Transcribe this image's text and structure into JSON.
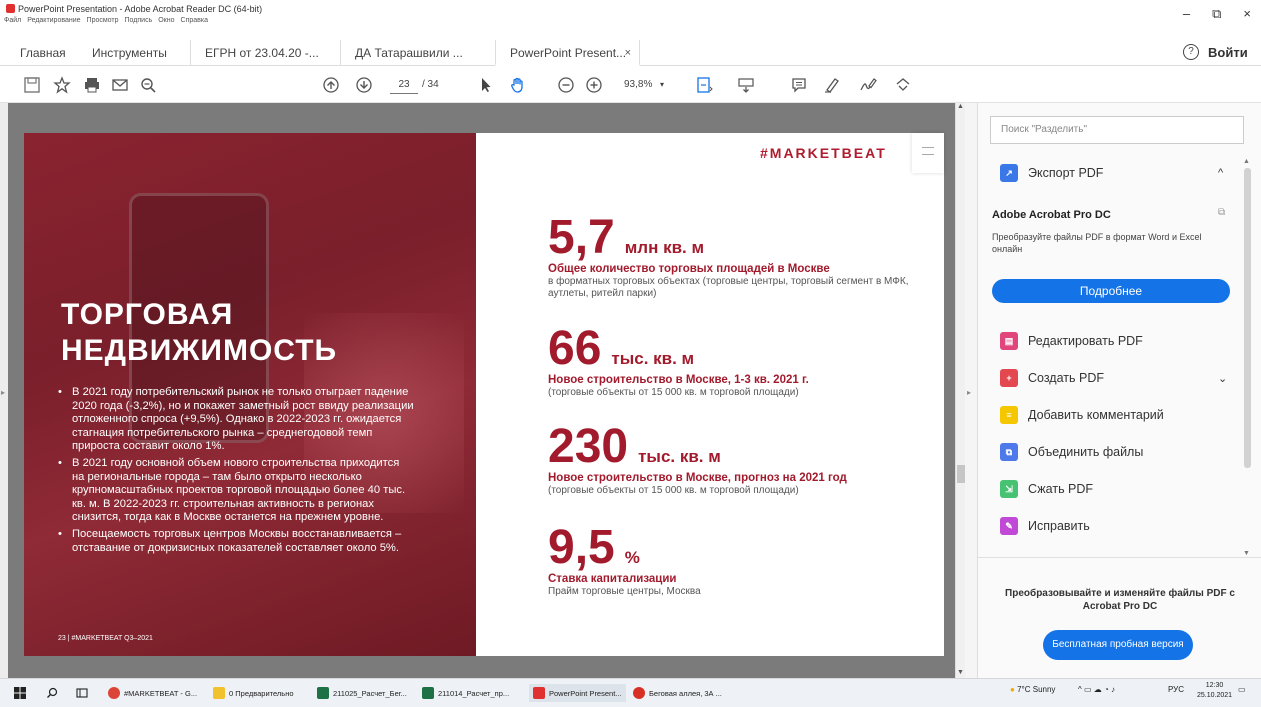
{
  "window": {
    "title": "PowerPoint Presentation - Adobe Acrobat Reader DC (64-bit)",
    "menu": [
      "Файл",
      "Редактирование",
      "Просмотр",
      "Подпись",
      "Окно",
      "Справка"
    ],
    "controls": {
      "minimize": "–",
      "maximize": "⧉",
      "close": "×"
    }
  },
  "tabs": {
    "home": "Главная",
    "tools": "Инструменты",
    "docs": [
      {
        "label": "ЕГРН от 23.04.20 -..."
      },
      {
        "label": "ДА Татарашвили ..."
      },
      {
        "label": "PowerPoint Present...",
        "close": "×"
      }
    ],
    "help": "?",
    "login": "Войти"
  },
  "toolbar": {
    "page_current": "23",
    "page_total": "/ 34",
    "zoom": "93,8%",
    "zoom_arrow": "▾"
  },
  "slide": {
    "hero_title_line1": "ТОРГОВАЯ",
    "hero_title_line2": "НЕДВИЖИМОСТЬ",
    "bullets": [
      "В 2021 году потребительский рынок не только отыграет падение 2020 года (-3,2%), но и покажет заметный рост ввиду реализации отложенного спроса (+9,5%). Однако в 2022-2023 гг. ожидается стагнация потребительского рынка – среднегодовой темп прироста составит около 1%.",
      "В 2021 году основной объем нового строительства приходится на региональные города – там было открыто несколько крупномасштабных проектов торговой площадью более 40 тыс. кв. м. В 2022-2023 гг. строительная активность в регионах снизится, тогда как в Москве останется на прежнем уровне.",
      "Посещаемость торговых центров Москвы восстанавливается – отставание от докризисных показателей составляет около 5%."
    ],
    "footer": "23    |  #MARKETBEAT Q3–2021",
    "brand": "#MARKETBEAT",
    "stats": [
      {
        "value": "5,7",
        "unit": "млн кв. м",
        "head": "Общее количество торговых площадей в Москве",
        "sub": "в форматных торговых объектах (торговые центры, торговый сегмент в МФК, аутлеты, ритейл парки)"
      },
      {
        "value": "66",
        "unit": "тыс. кв. м",
        "head": "Новое строительство в Москве, 1-3 кв. 2021 г.",
        "sub": "(торговые объекты от 15 000 кв. м торговой площади)"
      },
      {
        "value": "230",
        "unit": "тыс. кв. м",
        "head": "Новое строительство в Москве, прогноз на 2021 год",
        "sub": "(торговые объекты от 15 000 кв. м торговой площади)"
      },
      {
        "value": "9,5",
        "unit": "%",
        "head": "Ставка капитализации",
        "sub": "Прайм торговые центры, Москва"
      }
    ]
  },
  "sidebar": {
    "search_placeholder": "Поиск \"Разделить\"",
    "export": {
      "label": "Экспорт PDF",
      "chevron": "^"
    },
    "promo_title": "Adobe Acrobat Pro DC",
    "promo_sub": "Преобразуйте файлы PDF в формат Word и Excel онлайн",
    "more_button": "Подробнее",
    "tools": [
      {
        "label": "Редактировать PDF",
        "color": "#e0457b"
      },
      {
        "label": "Создать PDF",
        "color": "#e34850",
        "chevron": "⌄"
      },
      {
        "label": "Добавить комментарий",
        "color": "#f5c700"
      },
      {
        "label": "Объединить файлы",
        "color": "#4d7ae8"
      },
      {
        "label": "Сжать PDF",
        "color": "#47c272"
      },
      {
        "label": "Исправить",
        "color": "#c04ad6"
      }
    ],
    "upsell": "Преобразовывайте и изменяйте файлы PDF с Acrobat Pro DC",
    "trial_button": "Бесплатная пробная версия"
  },
  "taskbar": {
    "apps": [
      {
        "label": "#MARKETBEAT - G...",
        "color": "#db4437"
      },
      {
        "label": "0 Предварительно",
        "color": "#f2c12e"
      },
      {
        "label": "211025_Расчет_Бег...",
        "color": "#1e7145"
      },
      {
        "label": "211014_Расчет_пр...",
        "color": "#1e7145"
      },
      {
        "label": "PowerPoint Present...",
        "color": "#e03030"
      },
      {
        "label": "Беговая аллея, 3А ...",
        "color": "#d93025"
      }
    ],
    "weather": "7°C  Sunny",
    "lang": "РУС",
    "time": "12:30",
    "date": "25.10.2021"
  }
}
